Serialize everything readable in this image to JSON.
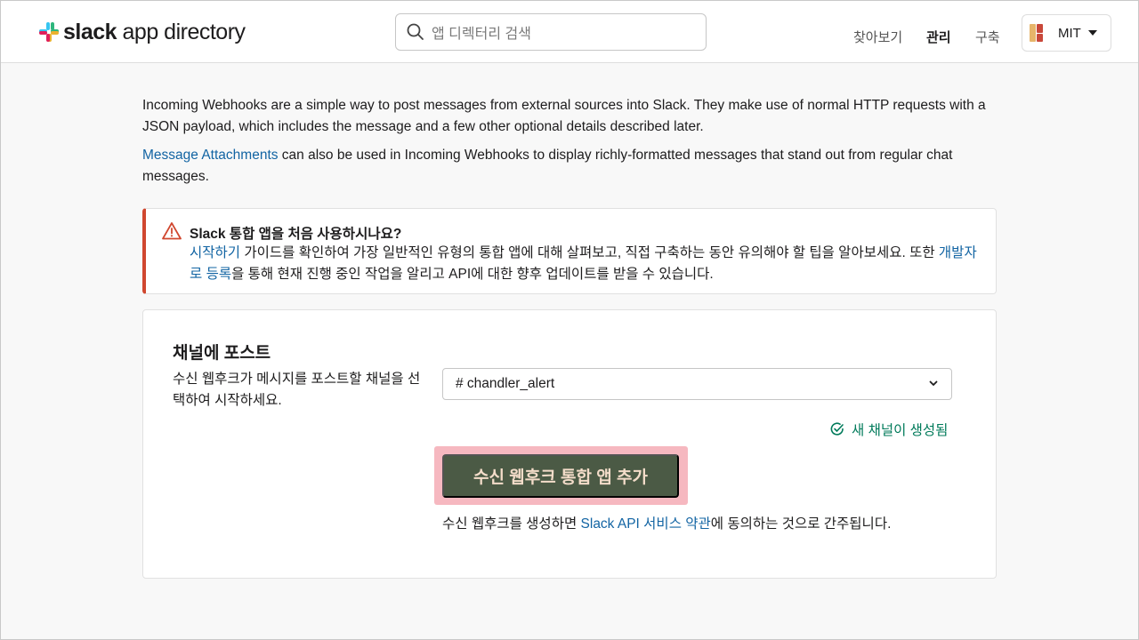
{
  "header": {
    "logo_bold": "slack",
    "logo_rest": " app directory",
    "search_placeholder": "앱 디렉터리 검색",
    "nav": [
      "찾아보기",
      "관리",
      "구축"
    ],
    "workspace": "MIT"
  },
  "intro": {
    "p1": "Incoming Webhooks are a simple way to post messages from external sources into Slack. They make use of normal HTTP requests with a JSON payload, which includes the message and a few other optional details described later.",
    "p2_link": "Message Attachments",
    "p2_rest": " can also be used in Incoming Webhooks to display richly-formatted messages that stand out from regular chat messages."
  },
  "callout": {
    "title": "Slack 통합 앱을 처음 사용하시나요?",
    "link1": "시작하기",
    "text1": " 가이드를 확인하여 가장 일반적인 유형의 통합 앱에 대해 살펴보고, 직접 구축하는 동안 유의해야 할 팁을 알아보세요. 또한 ",
    "link2": "개발자로 등록",
    "text2": "을 통해 현재 진행 중인 작업을 알리고 API에 대한 향후 업데이트를 받을 수 있습니다."
  },
  "card": {
    "title": "채널에 포스트",
    "desc": "수신 웹후크가 메시지를 포스트할 채널을 선택하여 시작하세요.",
    "selected_channel": "# chandler_alert",
    "created_note": "새 채널이 생성됨",
    "button_label": "수신 웹후크 통합 앱 추가",
    "terms_pre": "수신 웹후크를 생성하면 ",
    "terms_link": "Slack API 서비스 약관",
    "terms_post": "에 동의하는 것으로 간주됩니다."
  },
  "colors": {
    "accent_link": "#1264a3",
    "warning": "#d0472f",
    "success": "#007a5a",
    "button_bg": "#4b5a45",
    "button_highlight": "#f6b8c0"
  }
}
